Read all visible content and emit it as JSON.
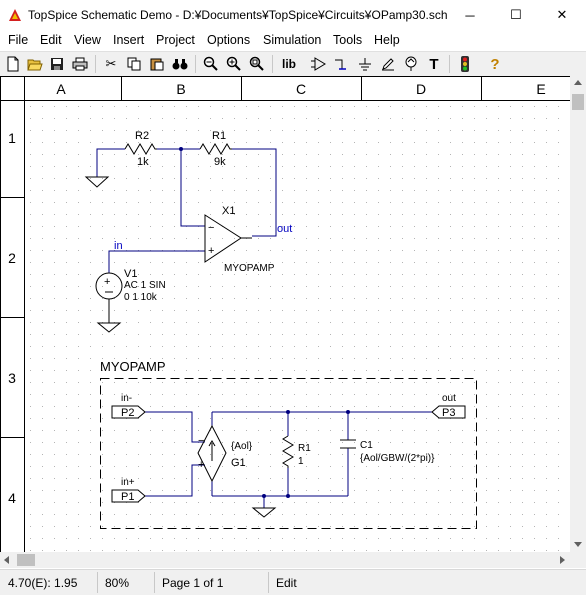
{
  "window": {
    "title": "TopSpice Schematic Demo - D:¥Documents¥TopSpice¥Circuits¥OPamp30.sch",
    "minimize_glyph": "─",
    "maximize_glyph": "☐",
    "close_glyph": "✕"
  },
  "menu": [
    "File",
    "Edit",
    "View",
    "Insert",
    "Project",
    "Options",
    "Simulation",
    "Tools",
    "Help"
  ],
  "toolbar": {
    "lib_label": "lib",
    "text_label": "T",
    "help_label": "?"
  },
  "grid": {
    "columns": [
      "A",
      "B",
      "C",
      "D",
      "E"
    ],
    "rows": [
      "1",
      "2",
      "3",
      "4"
    ]
  },
  "schematic": {
    "r2": {
      "ref": "R2",
      "value": "1k"
    },
    "r1": {
      "ref": "R1",
      "value": "9k"
    },
    "x1": {
      "ref": "X1",
      "model": "MYOPAMP"
    },
    "out_label": "out",
    "in_label": "in",
    "v1": {
      "ref": "V1",
      "line1": "AC 1   SIN",
      "line2": "0 1 10k",
      "plus": "+"
    },
    "subckt": {
      "title": "MYOPAMP",
      "p2": {
        "name": "P2",
        "net": "in-"
      },
      "p1": {
        "name": "P1",
        "net": "in+"
      },
      "p3": {
        "name": "P3",
        "net": "out"
      },
      "g1": {
        "ref": "G1",
        "value": "{Aol}",
        "minus": "−",
        "plus": "+"
      },
      "r1": {
        "ref": "R1",
        "value": "1"
      },
      "c1": {
        "ref": "C1",
        "value": "{Aol/GBW/(2*pi)}"
      }
    }
  },
  "status": {
    "coords": "4.70(E): 1.95",
    "zoom": "80%",
    "page": "Page 1 of 1",
    "mode": "Edit"
  },
  "colors": {
    "wire": "#000080",
    "net_label": "#0000c0",
    "component": "#000000",
    "grid_dot": "#b4b4b4"
  }
}
